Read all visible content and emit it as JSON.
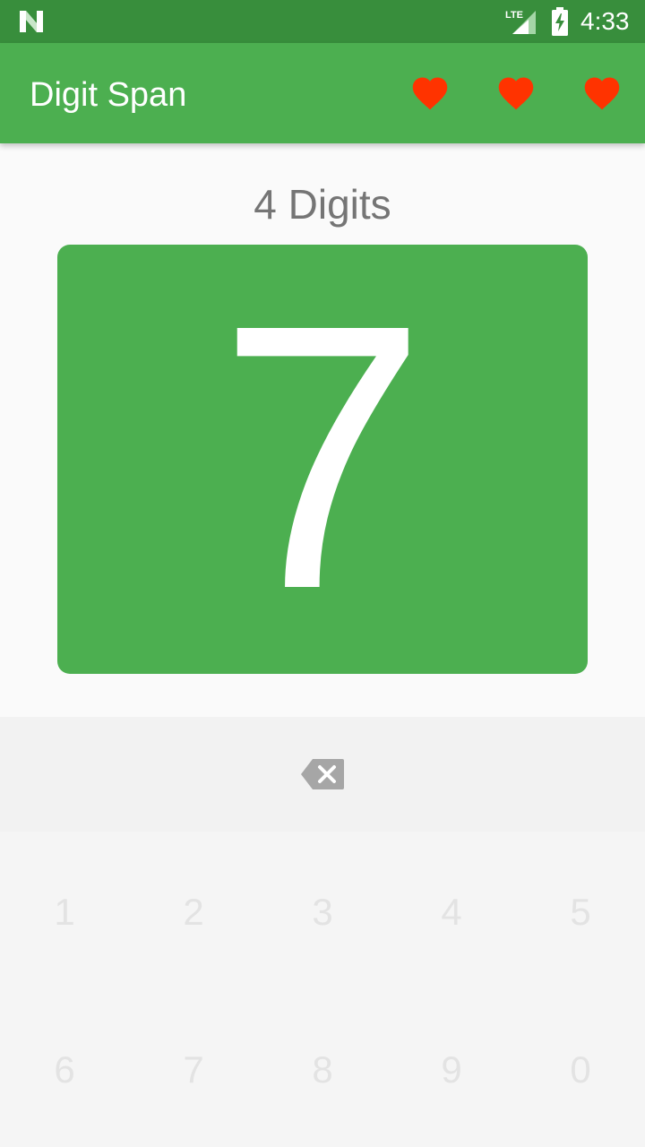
{
  "status_bar": {
    "time": "4:33",
    "network": "LTE",
    "icons": [
      "n-logo-icon",
      "lte-signal-icon",
      "battery-charging-icon"
    ]
  },
  "app_bar": {
    "title": "Digit Span",
    "lives": 3,
    "life_icon": "heart-icon",
    "life_color": "#ff3300"
  },
  "game": {
    "digit_count_label": "4 Digits",
    "current_digit": "7"
  },
  "input": {
    "backspace_icon": "backspace-icon",
    "keys_row1": [
      "1",
      "2",
      "3",
      "4",
      "5"
    ],
    "keys_row2": [
      "6",
      "7",
      "8",
      "9",
      "0"
    ]
  },
  "colors": {
    "primary": "#4caf50",
    "primary_dark": "#388e3c",
    "heart": "#ff3300",
    "text_secondary": "#757575"
  }
}
